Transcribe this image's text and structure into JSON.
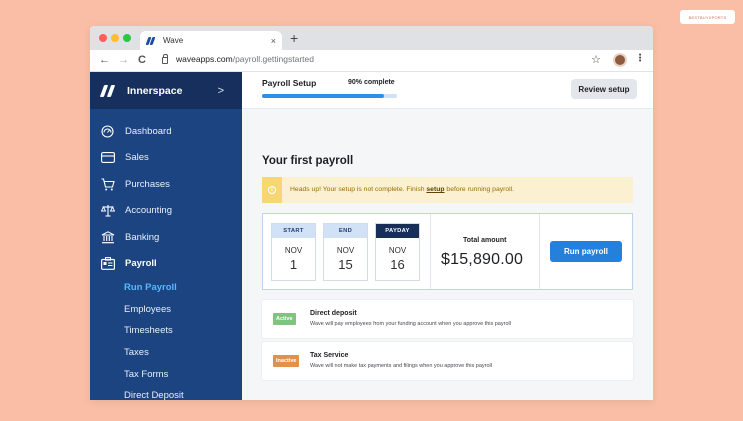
{
  "badge_text": "BESTBUYXPORTS",
  "browser": {
    "tab_title": "Wave",
    "tab_close": "×",
    "new_tab": "+",
    "url_host": "waveapps.com",
    "url_path": "/payroll.gettingstarted",
    "back": "←",
    "forward": "→",
    "reload": "C",
    "star": "☆",
    "menu": "⋮"
  },
  "sidebar": {
    "brand": "Innerspace",
    "brand_chevron": ">",
    "items": [
      {
        "label": "Dashboard",
        "icon": "dashboard-icon"
      },
      {
        "label": "Sales",
        "icon": "sales-icon"
      },
      {
        "label": "Purchases",
        "icon": "cart-icon"
      },
      {
        "label": "Accounting",
        "icon": "scale-icon"
      },
      {
        "label": "Banking",
        "icon": "bank-icon"
      },
      {
        "label": "Payroll",
        "icon": "payroll-icon"
      }
    ],
    "payroll_sub": [
      "Run Payroll",
      "Employees",
      "Timesheets",
      "Taxes",
      "Tax Forms",
      "Direct Deposit"
    ]
  },
  "setup": {
    "title": "Payroll Setup",
    "progress_label": "90% complete",
    "progress_value": 90,
    "review_button": "Review setup"
  },
  "main": {
    "page_title": "Your first payroll",
    "alert": {
      "icon": "i",
      "text_before": "Heads up! Your setup is not complete. Finish ",
      "link": "setup",
      "text_after": " before running payroll."
    },
    "dates": [
      {
        "head": "START",
        "month": "NOV",
        "day": "1"
      },
      {
        "head": "END",
        "month": "NOV",
        "day": "15"
      },
      {
        "head": "PAYDAY",
        "month": "NOV",
        "day": "16"
      }
    ],
    "total_label": "Total amount",
    "total_value": "$15,890.00",
    "run_button": "Run payroll"
  },
  "services": [
    {
      "status": "Active",
      "title": "Direct deposit",
      "description": "Wave will pay employees from your funding account when you approve this payroll"
    },
    {
      "status": "Inactive",
      "title": "Tax Service",
      "description": "Wave will not make tax payments and filings when you approve this payroll"
    }
  ],
  "colors": {
    "background": "#f9bea5",
    "sidebar": "#1c4481",
    "accent": "#2580dc",
    "active_sub": "#57b9ff"
  }
}
